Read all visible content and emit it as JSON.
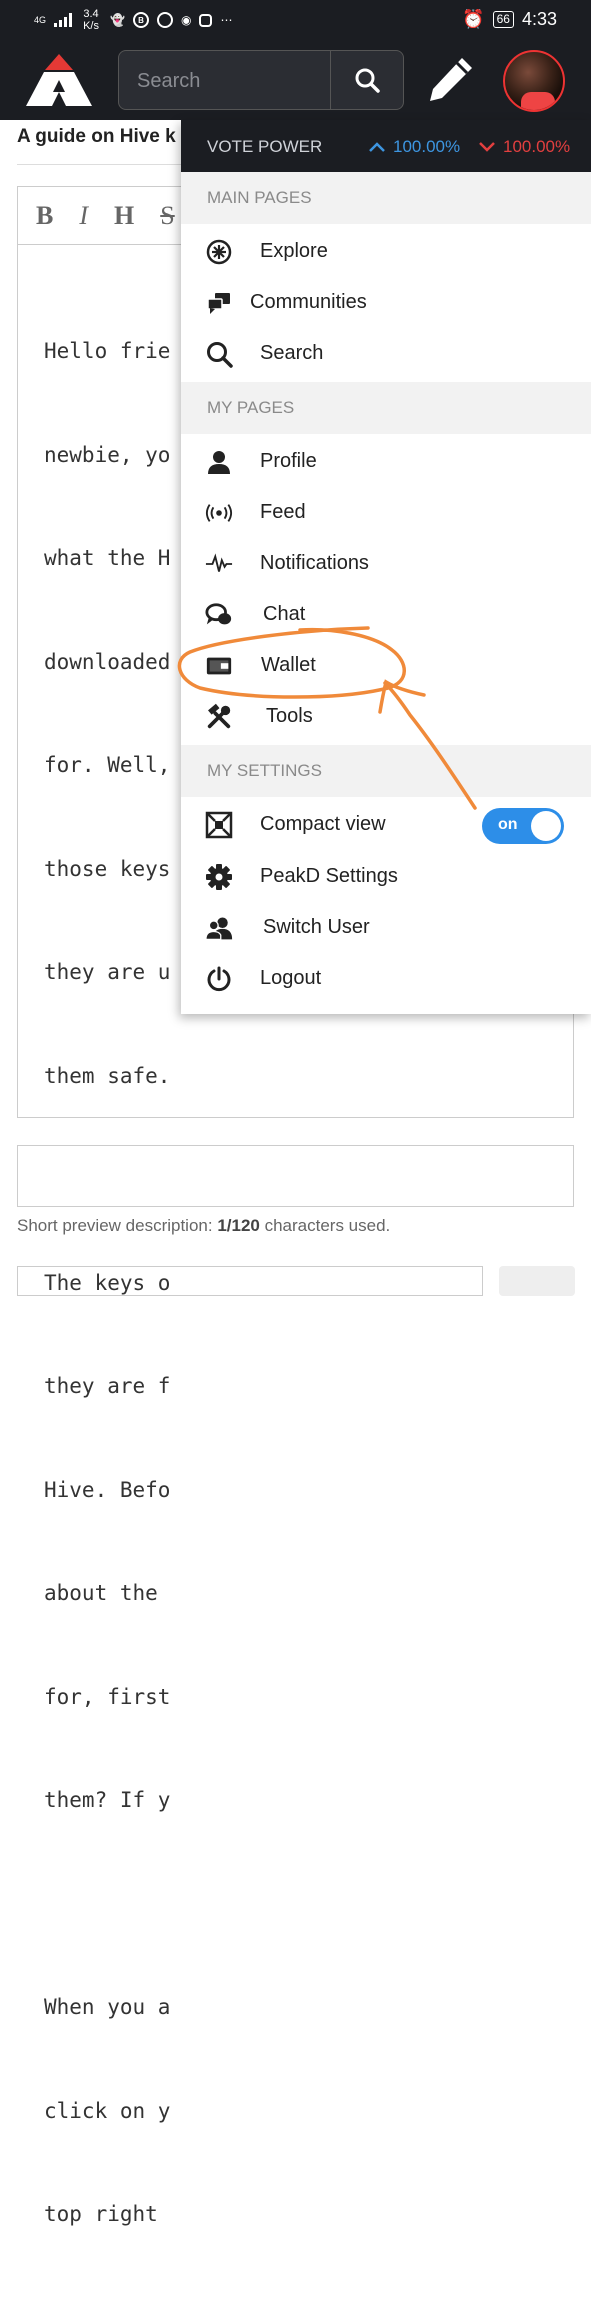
{
  "status_bar": {
    "network": "4G",
    "speed": "3.4 K/s",
    "battery": "66",
    "time": "4:33",
    "icons": [
      "signal-icon",
      "snapchat-icon",
      "b-icon",
      "o-icon",
      "discord-icon",
      "instagram-icon",
      "more-icon",
      "alarm-icon",
      "battery-icon"
    ]
  },
  "header": {
    "search_placeholder": "Search",
    "logo_icon": "peakd-logo",
    "compose_icon": "pencil-icon",
    "avatar_icon": "user-avatar"
  },
  "editor": {
    "title_value": "A guide on Hive k",
    "toolbar": [
      "B",
      "I",
      "H",
      "S"
    ],
    "lines": [
      "Hello frie",
      "newbie, yo",
      "what the H",
      "downloaded",
      "for. Well,",
      "those keys",
      "they are u",
      "them safe.",
      "",
      "The keys o",
      "they are f",
      "Hive. Befo",
      "about the ",
      "for, first",
      "them? If y",
      "",
      "When you a",
      "click on y",
      "top right "
    ]
  },
  "preview": {
    "note_prefix": "Short preview description: ",
    "count": "1/120",
    "note_suffix": " characters used."
  },
  "menu": {
    "vote_power_label": "VOTE POWER",
    "upvote_power": "100.00%",
    "downvote_power": "100.00%",
    "colors": {
      "up": "#3d95e0",
      "down": "#e23f3f",
      "annotation": "#f08a3a",
      "toggle": "#2d8ee8"
    },
    "main_pages_label": "MAIN PAGES",
    "main_pages": [
      {
        "label": "Explore",
        "icon": "compass-icon"
      },
      {
        "label": "Communities",
        "icon": "chat-bubbles-icon"
      },
      {
        "label": "Search",
        "icon": "search-icon"
      }
    ],
    "my_pages_label": "MY PAGES",
    "my_pages": [
      {
        "label": "Profile",
        "icon": "person-icon"
      },
      {
        "label": "Feed",
        "icon": "broadcast-icon"
      },
      {
        "label": "Notifications",
        "icon": "pulse-icon"
      },
      {
        "label": "Chat",
        "icon": "chat-icon"
      },
      {
        "label": "Wallet",
        "icon": "wallet-icon"
      },
      {
        "label": "Tools",
        "icon": "tools-icon"
      }
    ],
    "my_settings_label": "MY SETTINGS",
    "settings": [
      {
        "label": "Compact view",
        "icon": "compact-view-icon",
        "toggle": "on"
      },
      {
        "label": "PeakD Settings",
        "icon": "gear-icon"
      },
      {
        "label": "Switch User",
        "icon": "switch-user-icon"
      },
      {
        "label": "Logout",
        "icon": "power-icon"
      }
    ]
  }
}
